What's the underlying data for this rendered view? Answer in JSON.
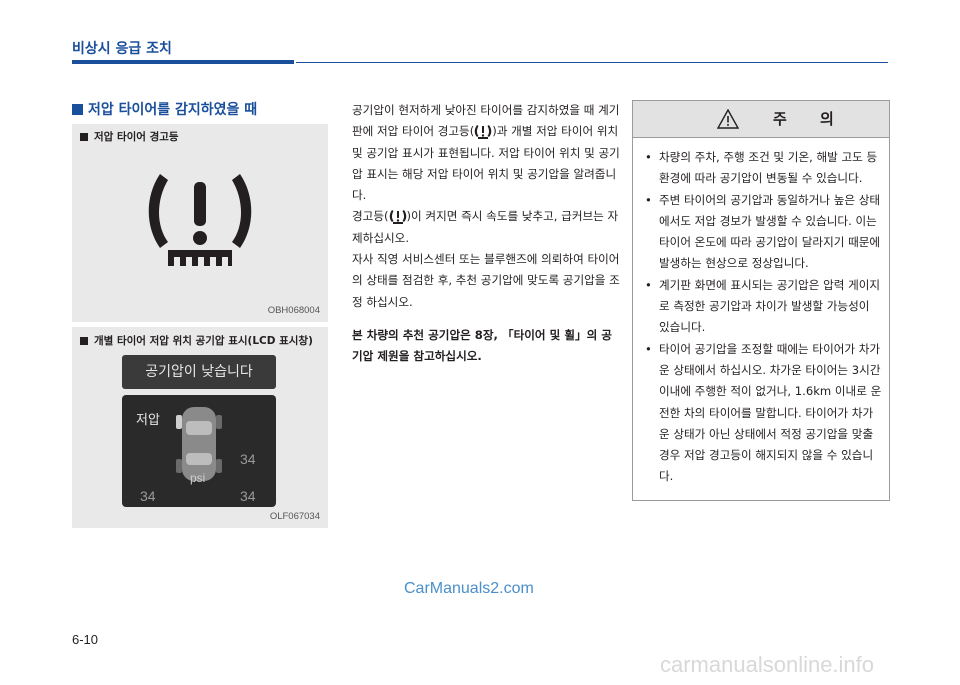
{
  "header": {
    "title": "비상시 응급 조치"
  },
  "section": {
    "title": "저압 타이어를 감지하였을 때"
  },
  "figure1": {
    "caption": "저압 타이어 경고등",
    "code": "OBH068004"
  },
  "figure2": {
    "caption": "개별 타이어 저압 위치 공기압 표시(LCD 표시창)",
    "code": "OLF067034",
    "lcd_banner": "공기압이 낮습니다",
    "lcd_low_label": "저압",
    "values": {
      "front_left": "",
      "front_right": "34",
      "rear_left": "34",
      "rear_right": "34"
    },
    "unit": "psi"
  },
  "body": {
    "p1_a": "공기압이 현저하게 낮아진 타이어를 감지하였을 때 계기판에 저압 타이어 경고등(",
    "p1_b": ")과 개별 저압 타이어 위치 및 공기압 표시가 표현됩니다. 저압 타이어 위치 및 공기압 표시는 해당 저압 타이어 위치 및 공기압을 알려줍니다.",
    "p2_a": "경고등(",
    "p2_b": ")이 켜지면 즉시 속도를 낮추고, 급커브는 자제하십시오.",
    "p3": "자사 직영 서비스센터 또는 블루핸즈에 의뢰하여 타이어의 상태를 점검한 후, 추천 공기압에 맞도록 공기압을 조정 하십시오.",
    "p4": "본 차량의 추천 공기압은 8장, 「타이어 및 휠」의 공기압 제원을 참고하십시오."
  },
  "caution": {
    "title": "주 의",
    "items": [
      "차량의 주차, 주행 조건 및 기온, 해발 고도 등 환경에 따라 공기압이 변동될 수 있습니다.",
      "주변 타이어의 공기압과 동일하거나 높은 상태에서도 저압 경보가 발생할 수 있습니다. 이는 타이어 온도에 따라 공기압이 달라지기 때문에 발생하는 현상으로 정상입니다.",
      "계기판 화면에 표시되는 공기압은 압력 게이지로 측정한 공기압과 차이가 발생할 가능성이 있습니다.",
      "타이어 공기압을 조정할 때에는 타이어가 차가운 상태에서 하십시오. 차가운 타이어는 3시간 이내에 주행한 적이 없거나, 1.6km 이내로 운전한 차의 타이어를 말합니다. 타이어가 차가운 상태가 아닌 상태에서 적정 공기압을 맞출 경우 저압 경고등이 해지되지 않을 수 있습니다."
    ]
  },
  "footer": {
    "page_number": "6-10",
    "watermark": "CarManuals2.com",
    "site_watermark": "carmanualsonline.info"
  },
  "icons": {
    "tpms": "tpms-warning-icon",
    "caution": "warning-triangle-icon",
    "car": "car-top-view-icon"
  }
}
